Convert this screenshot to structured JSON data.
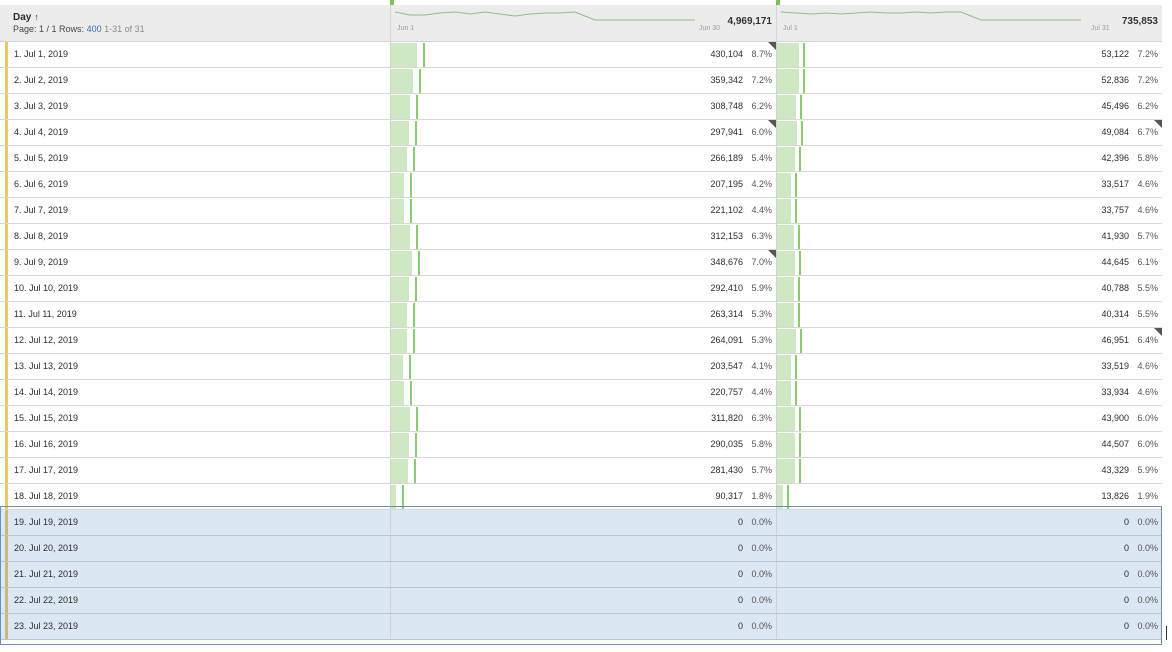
{
  "header": {
    "dimension_title": "Day",
    "sort_icon": "↑",
    "page_label": "Page: 1 / 1 Rows:",
    "rows_value": "400",
    "range_label": "1-31 of 31",
    "metric1": {
      "total": "4,969,171",
      "axis_start": "Jun 1",
      "axis_end": "Jun 30"
    },
    "metric2": {
      "total": "735,853",
      "axis_start": "Jul 1",
      "axis_end": "Jul 31"
    }
  },
  "rows": [
    {
      "label": "1. Jul 1, 2019",
      "m1": "430,104",
      "p1": "8.7%",
      "m2": "53,122",
      "p2": "7.2%",
      "f1": true,
      "f2": false,
      "sel": false
    },
    {
      "label": "2. Jul 2, 2019",
      "m1": "359,342",
      "p1": "7.2%",
      "m2": "52,836",
      "p2": "7.2%",
      "f1": false,
      "f2": false,
      "sel": false
    },
    {
      "label": "3. Jul 3, 2019",
      "m1": "308,748",
      "p1": "6.2%",
      "m2": "45,496",
      "p2": "6.2%",
      "f1": false,
      "f2": false,
      "sel": false
    },
    {
      "label": "4. Jul 4, 2019",
      "m1": "297,941",
      "p1": "6.0%",
      "m2": "49,084",
      "p2": "6.7%",
      "f1": true,
      "f2": true,
      "sel": false
    },
    {
      "label": "5. Jul 5, 2019",
      "m1": "266,189",
      "p1": "5.4%",
      "m2": "42,396",
      "p2": "5.8%",
      "f1": false,
      "f2": false,
      "sel": false
    },
    {
      "label": "6. Jul 6, 2019",
      "m1": "207,195",
      "p1": "4.2%",
      "m2": "33,517",
      "p2": "4.6%",
      "f1": false,
      "f2": false,
      "sel": false
    },
    {
      "label": "7. Jul 7, 2019",
      "m1": "221,102",
      "p1": "4.4%",
      "m2": "33,757",
      "p2": "4.6%",
      "f1": false,
      "f2": false,
      "sel": false
    },
    {
      "label": "8. Jul 8, 2019",
      "m1": "312,153",
      "p1": "6.3%",
      "m2": "41,930",
      "p2": "5.7%",
      "f1": false,
      "f2": false,
      "sel": false
    },
    {
      "label": "9. Jul 9, 2019",
      "m1": "348,676",
      "p1": "7.0%",
      "m2": "44,645",
      "p2": "6.1%",
      "f1": true,
      "f2": false,
      "sel": false
    },
    {
      "label": "10. Jul 10, 2019",
      "m1": "292,410",
      "p1": "5.9%",
      "m2": "40,788",
      "p2": "5.5%",
      "f1": false,
      "f2": false,
      "sel": false
    },
    {
      "label": "11. Jul 11, 2019",
      "m1": "263,314",
      "p1": "5.3%",
      "m2": "40,314",
      "p2": "5.5%",
      "f1": false,
      "f2": false,
      "sel": false
    },
    {
      "label": "12. Jul 12, 2019",
      "m1": "264,091",
      "p1": "5.3%",
      "m2": "46,951",
      "p2": "6.4%",
      "f1": false,
      "f2": true,
      "sel": false
    },
    {
      "label": "13. Jul 13, 2019",
      "m1": "203,547",
      "p1": "4.1%",
      "m2": "33,519",
      "p2": "4.6%",
      "f1": false,
      "f2": false,
      "sel": false
    },
    {
      "label": "14. Jul 14, 2019",
      "m1": "220,757",
      "p1": "4.4%",
      "m2": "33,934",
      "p2": "4.6%",
      "f1": false,
      "f2": false,
      "sel": false
    },
    {
      "label": "15. Jul 15, 2019",
      "m1": "311,820",
      "p1": "6.3%",
      "m2": "43,900",
      "p2": "6.0%",
      "f1": false,
      "f2": false,
      "sel": false
    },
    {
      "label": "16. Jul 16, 2019",
      "m1": "290,035",
      "p1": "5.8%",
      "m2": "44,507",
      "p2": "6.0%",
      "f1": false,
      "f2": false,
      "sel": false
    },
    {
      "label": "17. Jul 17, 2019",
      "m1": "281,430",
      "p1": "5.7%",
      "m2": "43,329",
      "p2": "5.9%",
      "f1": false,
      "f2": false,
      "sel": false
    },
    {
      "label": "18. Jul 18, 2019",
      "m1": "90,317",
      "p1": "1.8%",
      "m2": "13,826",
      "p2": "1.9%",
      "f1": false,
      "f2": false,
      "sel": false
    },
    {
      "label": "19. Jul 19, 2019",
      "m1": "0",
      "p1": "0.0%",
      "m2": "0",
      "p2": "0.0%",
      "f1": false,
      "f2": false,
      "sel": true
    },
    {
      "label": "20. Jul 20, 2019",
      "m1": "0",
      "p1": "0.0%",
      "m2": "0",
      "p2": "0.0%",
      "f1": false,
      "f2": false,
      "sel": true
    },
    {
      "label": "21. Jul 21, 2019",
      "m1": "0",
      "p1": "0.0%",
      "m2": "0",
      "p2": "0.0%",
      "f1": false,
      "f2": false,
      "sel": true
    },
    {
      "label": "22. Jul 22, 2019",
      "m1": "0",
      "p1": "0.0%",
      "m2": "0",
      "p2": "0.0%",
      "f1": false,
      "f2": false,
      "sel": true
    },
    {
      "label": "23. Jul 23, 2019",
      "m1": "0",
      "p1": "0.0%",
      "m2": "0",
      "p2": "0.0%",
      "f1": false,
      "f2": false,
      "sel": true
    }
  ],
  "colors": {
    "bar": "#cfe8c4",
    "bar_line": "#8ccc70",
    "marker": "#f0c75e",
    "selected_bg": "#dbe7f3",
    "link": "#2d6fb6"
  }
}
